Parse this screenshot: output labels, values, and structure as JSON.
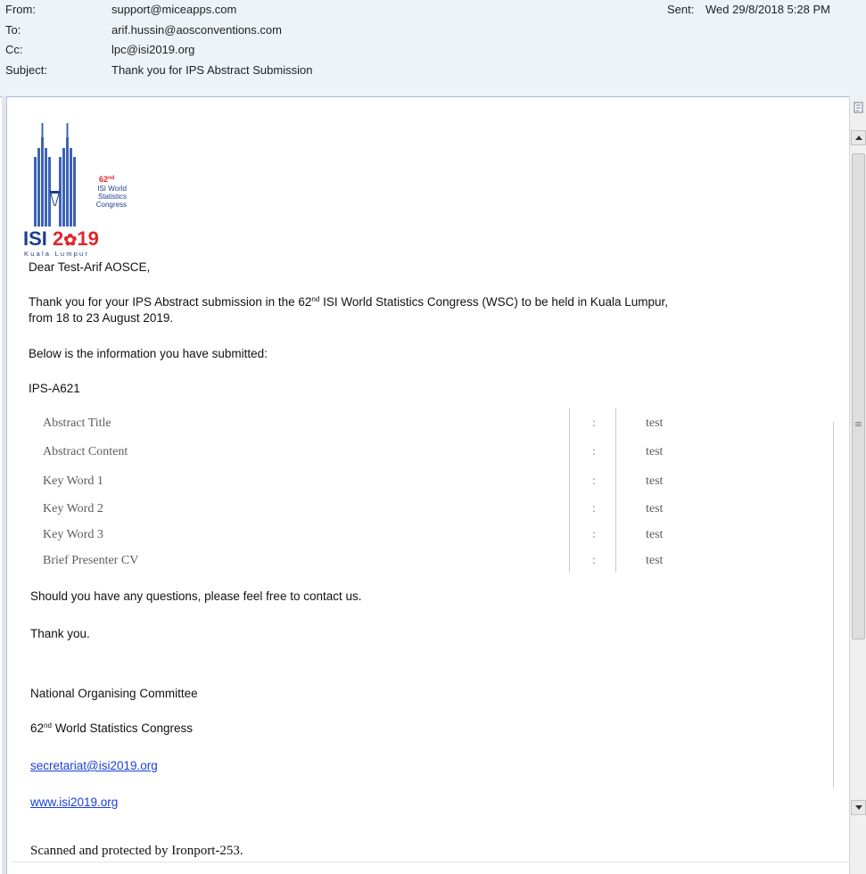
{
  "header": {
    "from_label": "From:",
    "from_value": "support@miceapps.com",
    "to_label": "To:",
    "to_value": "arif.hussin@aosconventions.com",
    "cc_label": "Cc:",
    "cc_value": "lpc@isi2019.org",
    "subject_label": "Subject:",
    "subject_value": "Thank you for IPS Abstract Submission",
    "sent_label": "Sent:",
    "sent_value": "Wed 29/8/2018 5:28 PM"
  },
  "logo": {
    "edition": "62",
    "edition_sup": "nd",
    "line1": "ISI World",
    "line2": "Statistics",
    "line3": "Congress",
    "brand_isi": "ISI",
    "brand_year_a": "2",
    "brand_year_b": "19",
    "city": "Kuala Lumpur",
    "colors": {
      "navy": "#1c3f8c",
      "red": "#e0262e",
      "tower": "#3d63b8"
    }
  },
  "body": {
    "greeting": "Dear Test-Arif AOSCE,",
    "intro_a": "Thank you for your IPS Abstract submission in the 62",
    "intro_sup": "nd",
    "intro_b": " ISI World Statistics Congress (WSC) to be held in Kuala Lumpur,",
    "intro_line2": "from 18 to 23 August 2019.",
    "below": "Below is the information you have submitted:",
    "ref_id": "IPS-A621",
    "table": [
      {
        "label": "Abstract Title",
        "sep": ":",
        "value": "test"
      },
      {
        "label": "Abstract Content",
        "sep": ":",
        "value": "test"
      },
      {
        "label": "Key Word 1",
        "sep": ":",
        "value": "test"
      },
      {
        "label": "Key Word 2",
        "sep": ":",
        "value": "test"
      },
      {
        "label": "Key Word 3",
        "sep": ":",
        "value": "test"
      },
      {
        "label": "Brief Presenter CV",
        "sep": ":",
        "value": "test"
      }
    ],
    "questions": "Should you have any questions, please feel free to contact us.",
    "thanks": "Thank you.",
    "committee": "National Organising Committee",
    "congress_a": "62",
    "congress_sup": "nd",
    "congress_b": " World Statistics Congress",
    "email_link": "secretariat@isi2019.org",
    "web_link": "www.isi2019.org",
    "scanned": "Scanned and protected by Ironport-253."
  }
}
